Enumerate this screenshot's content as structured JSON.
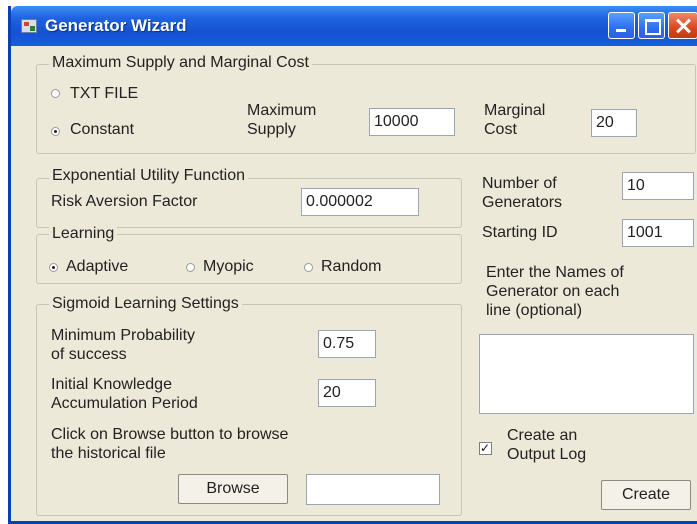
{
  "window": {
    "title": "Generator Wizard"
  },
  "supply_group": {
    "title": "Maximum Supply and Marginal Cost",
    "options": [
      {
        "label": "TXT FILE",
        "checked": false
      },
      {
        "label": "Constant",
        "checked": true
      }
    ],
    "max_supply_label_1": "Maximum",
    "max_supply_label_2": "Supply",
    "max_supply_value": "10000",
    "marginal_cost_label_1": "Marginal",
    "marginal_cost_label_2": "Cost",
    "marginal_cost_value": "20"
  },
  "utility_group": {
    "title": "Exponential Utility Function",
    "risk_label": "Risk Aversion Factor",
    "risk_value": "0.000002"
  },
  "learning_group": {
    "title": "Learning",
    "options": [
      {
        "label": "Adaptive",
        "checked": true
      },
      {
        "label": "Myopic",
        "checked": false
      },
      {
        "label": "Random",
        "checked": false
      }
    ]
  },
  "sigmoid_group": {
    "title": "Sigmoid Learning Settings",
    "min_prob_label_1": "Minimum Probability",
    "min_prob_label_2": "of success",
    "min_prob_value": "0.75",
    "knowledge_label_1": "Initial Knowledge",
    "knowledge_label_2": "Accumulation Period",
    "knowledge_value": "20",
    "browse_hint_1": "Click on Browse button to browse",
    "browse_hint_2": "the historical file",
    "browse_button": "Browse",
    "file_value": ""
  },
  "right_panel": {
    "num_generators_label_1": "Number of",
    "num_generators_label_2": "Generators",
    "num_generators_value": "10",
    "starting_id_label": "Starting ID",
    "starting_id_value": "1001",
    "names_hint_1": "Enter the Names of",
    "names_hint_2": "Generator on each",
    "names_hint_3": "line (optional)",
    "names_value": "",
    "output_log_label_1": "Create an",
    "output_log_label_2": "Output Log",
    "output_log_checked": true,
    "create_button": "Create"
  }
}
